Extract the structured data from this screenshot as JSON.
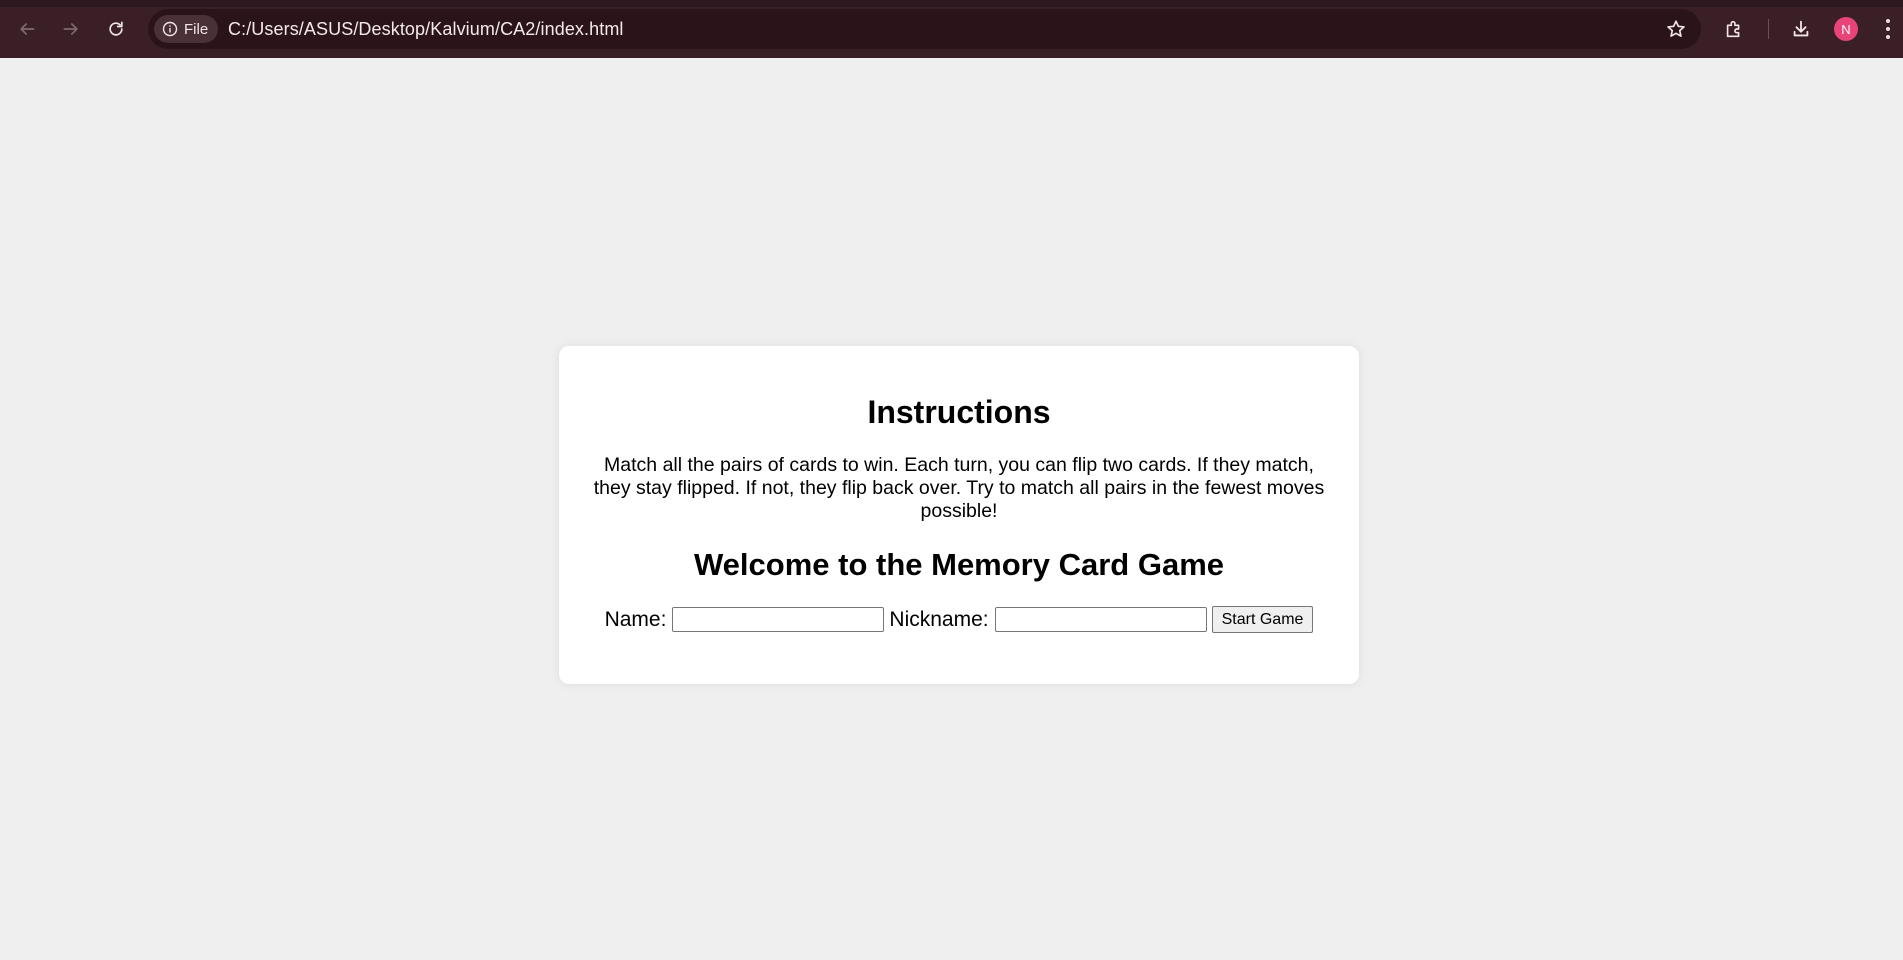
{
  "browser": {
    "file_chip_label": "File",
    "url": "C:/Users/ASUS/Desktop/Kalvium/CA2/index.html",
    "profile_initial": "N",
    "icons": [
      "back-arrow-icon",
      "forward-arrow-icon",
      "reload-icon",
      "info-icon",
      "star-icon",
      "extensions-icon",
      "download-icon",
      "kebab-menu-icon"
    ]
  },
  "page": {
    "instructions_heading": "Instructions",
    "instructions_text": "Match all the pairs of cards to win. Each turn, you can flip two cards. If they match, they stay flipped. If not, they flip back over. Try to match all pairs in the fewest moves possible!",
    "welcome_heading": "Welcome to the Memory Card Game",
    "name_label": "Name:",
    "name_value": "",
    "nickname_label": "Nickname:",
    "nickname_value": "",
    "start_button_label": "Start Game"
  },
  "colors": {
    "chrome_bg": "#3b1f27",
    "omnibox_bg": "#2a1419",
    "page_bg": "#efefef",
    "card_bg": "#ffffff",
    "avatar_bg": "#e8447a"
  }
}
